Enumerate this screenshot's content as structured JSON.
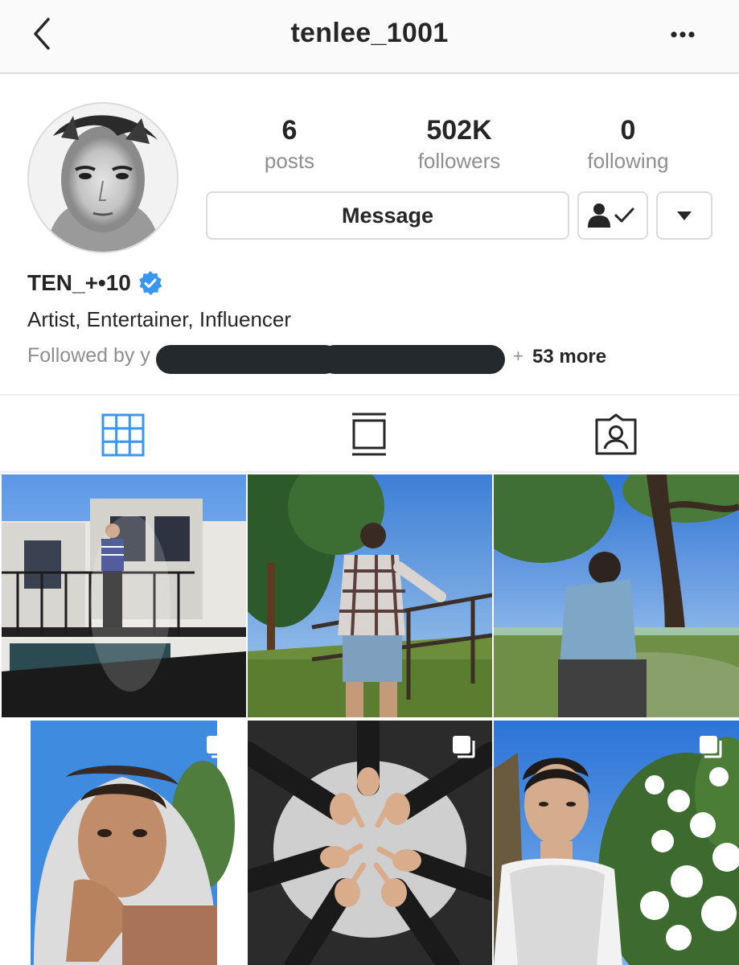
{
  "header": {
    "username": "tenlee_1001"
  },
  "stats": [
    {
      "number": "6",
      "label": "posts"
    },
    {
      "number": "502K",
      "label": "followers"
    },
    {
      "number": "0",
      "label": "following"
    }
  ],
  "actions": {
    "message_label": "Message"
  },
  "profile": {
    "name": "TEN_+•10",
    "bio": "Artist, Entertainer, Influencer",
    "followed_by": "Followed by y",
    "followed_sep": "y",
    "followed_plus": "+",
    "followed_more": "53 more"
  },
  "icons": {
    "back": "chevron-left-icon",
    "more": "more-horizontal-icon",
    "following": "person-check-icon",
    "dropdown": "caret-down-icon",
    "verified": "verified-badge-icon",
    "grid_tab": "grid-icon",
    "igtv_tab": "feed-view-icon",
    "tagged_tab": "tagged-person-icon",
    "multi_post": "carousel-icon"
  },
  "colors": {
    "accent_blue": "#3897f0",
    "text": "#262626",
    "muted": "#8e8e8e",
    "border": "#dbdbdb"
  },
  "posts": [
    {
      "scene": "man standing on balcony of white house",
      "carousel": false
    },
    {
      "scene": "man in plaid shirt leaning on railing outdoors",
      "carousel": false
    },
    {
      "scene": "man in denim jacket under tree by river",
      "carousel": false
    },
    {
      "scene": "man with towel over head, hand on chin",
      "carousel": true
    },
    {
      "scene": "circle of hands making finger signs",
      "carousel": true
    },
    {
      "scene": "man in sweater vest beside white flowers",
      "carousel": true
    }
  ]
}
